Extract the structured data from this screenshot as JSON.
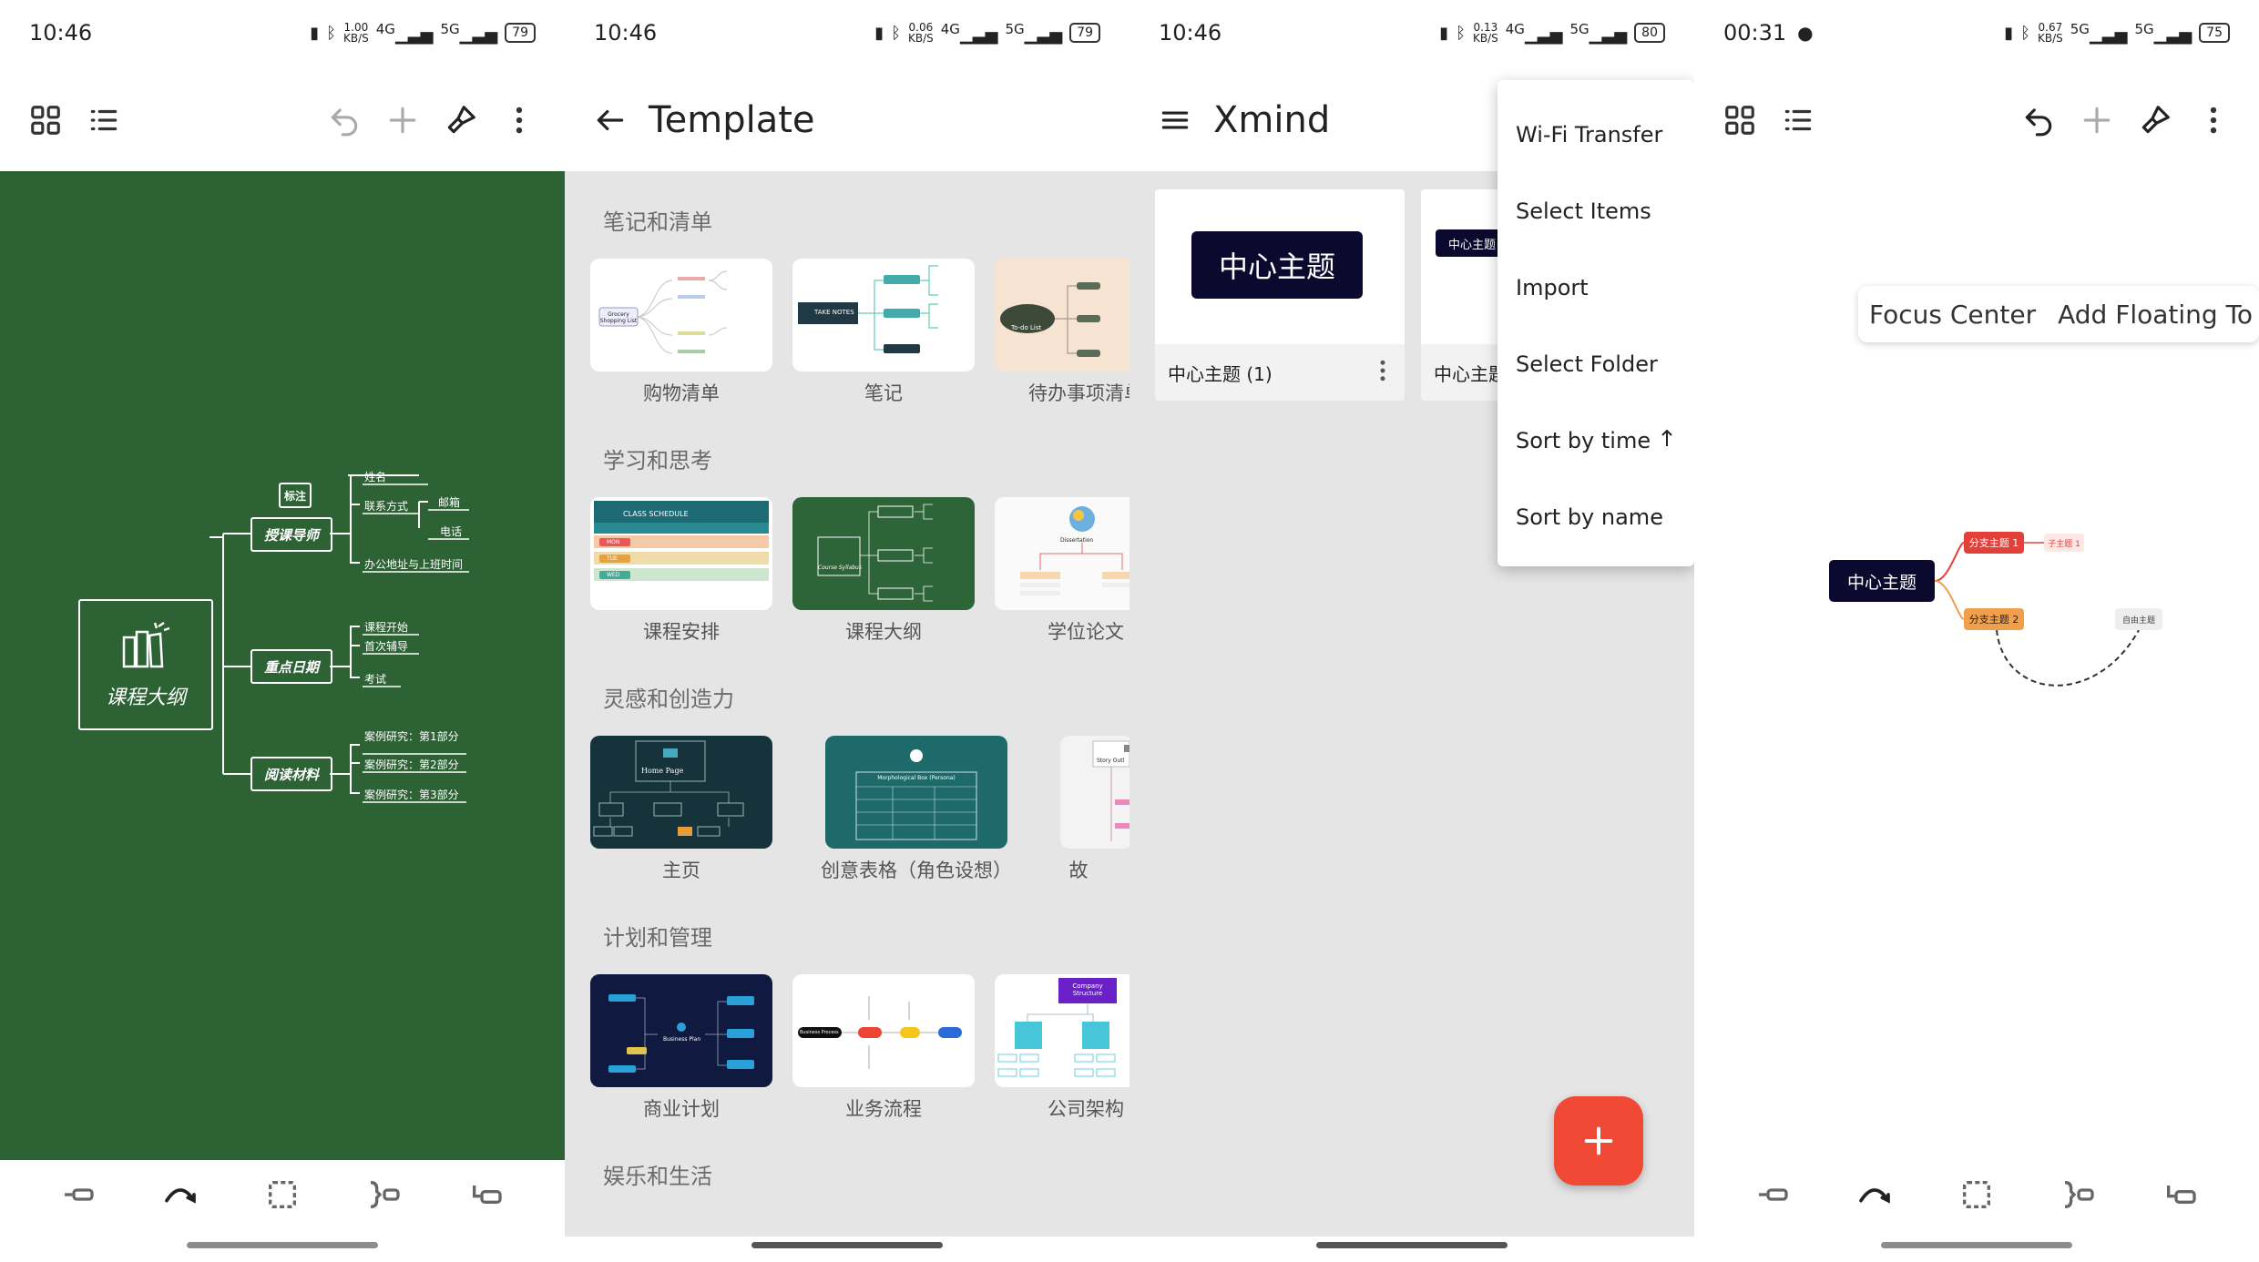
{
  "panel1": {
    "status": {
      "time": "10:46",
      "speed": "1.00\nKB/S",
      "net1": "4G",
      "net2": "5G",
      "battery": "79"
    },
    "map": {
      "central": "课程大纲",
      "note": "标注",
      "branches": [
        {
          "label": "授课导师",
          "children": [
            "姓名",
            "联系方式",
            "办公地址与上班时间"
          ],
          "grandchildren": [
            "邮箱",
            "电话"
          ]
        },
        {
          "label": "重点日期",
          "children": [
            "课程开始",
            "首次辅导",
            "考试"
          ]
        },
        {
          "label": "阅读材料",
          "children": [
            "案例研究：第1部分",
            "案例研究：第2部分",
            "案例研究：第3部分"
          ]
        }
      ]
    }
  },
  "panel2": {
    "status": {
      "time": "10:46",
      "speed": "0.06\nKB/S",
      "net1": "4G",
      "net2": "5G",
      "battery": "79"
    },
    "title": "Template",
    "sections": [
      {
        "title": "笔记和清单",
        "items": [
          "购物清单",
          "笔记",
          "待办事项清单"
        ]
      },
      {
        "title": "学习和思考",
        "items": [
          "课程安排",
          "课程大纲",
          "学位论文"
        ]
      },
      {
        "title": "灵感和创造力",
        "items": [
          "主页",
          "创意表格（角色设想）",
          "故"
        ]
      },
      {
        "title": "计划和管理",
        "items": [
          "商业计划",
          "业务流程",
          "公司架构"
        ]
      },
      {
        "title": "娱乐和生活",
        "items": []
      }
    ],
    "thumb_text": {
      "shopping": "Grocery Shopping List",
      "notes": "TAKE NOTES",
      "todo": "To-do List",
      "schedule_title": "CLASS SCHEDULE",
      "days": [
        "MON",
        "TUE",
        "WED"
      ],
      "syllabus": "Course Syllabus",
      "dissertation": "Dissertation",
      "homepage": "Home Page",
      "morph": "Morphological Box (Persona)",
      "story": "Story Outl",
      "bizplan": "Business Plan",
      "bizprocess": "Business Process",
      "company": "Company Structure"
    }
  },
  "panel3": {
    "status": {
      "time": "10:46",
      "speed": "0.13\nKB/S",
      "net1": "4G",
      "net2": "5G",
      "battery": "80"
    },
    "title": "Xmind",
    "cards": [
      {
        "thumb": "中心主题",
        "name": "中心主题 (1)"
      },
      {
        "thumb": "中心主题",
        "name": "中心主题"
      }
    ],
    "menu": [
      "Wi-Fi Transfer",
      "Select Items",
      "Import",
      "Select Folder",
      "Sort by time",
      "Sort by name"
    ]
  },
  "panel4": {
    "status": {
      "time": "00:31",
      "speed": "0.67\nKB/S",
      "net1": "5G",
      "net2": "5G",
      "battery": "75"
    },
    "chips": [
      "Focus Center",
      "Add Floating To"
    ],
    "map": {
      "central": "中心主题",
      "branch1": "分支主题 1",
      "sub1": "子主题 1",
      "branch2": "分支主题 2",
      "floating": "自由主题"
    }
  }
}
